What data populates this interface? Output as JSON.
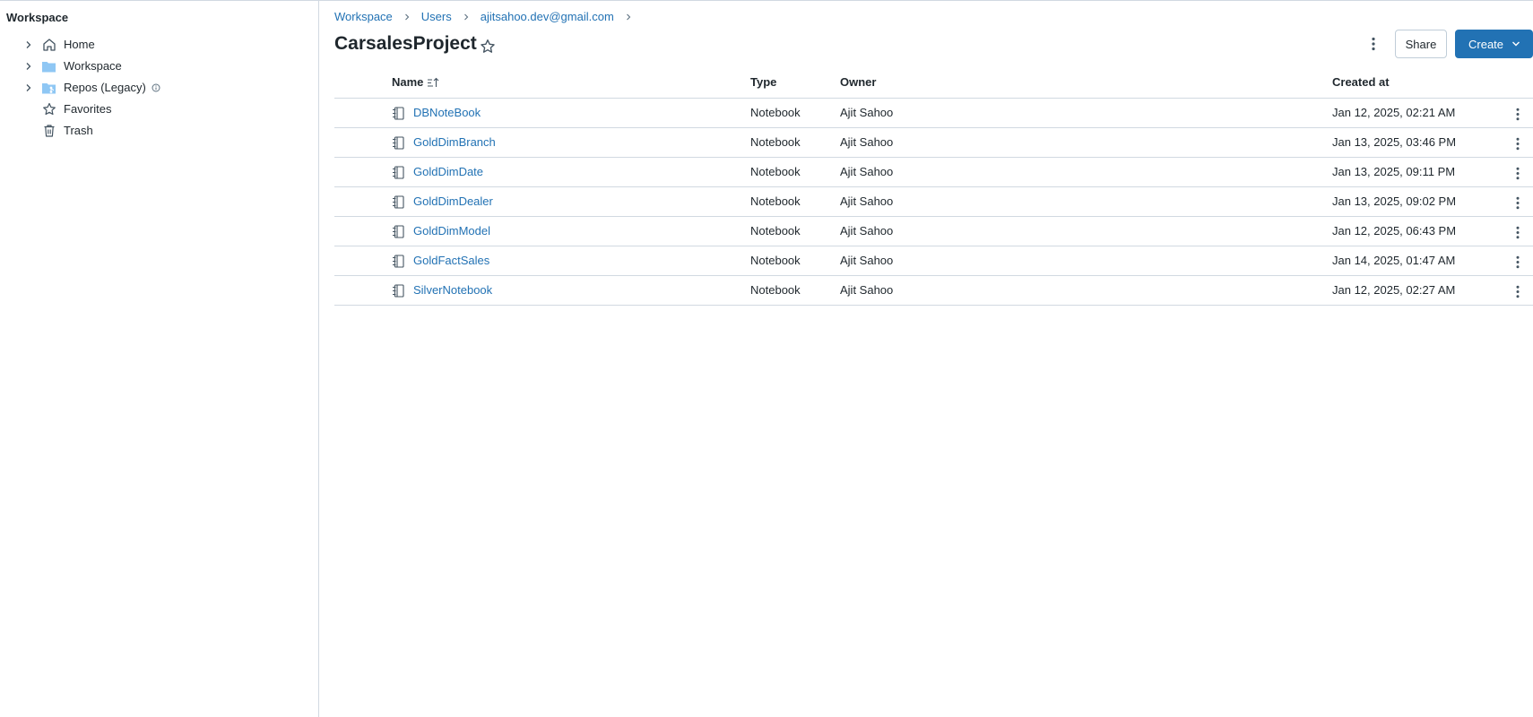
{
  "sidebar": {
    "title": "Workspace",
    "items": [
      {
        "label": "Home",
        "icon": "home-icon",
        "expandable": true
      },
      {
        "label": "Workspace",
        "icon": "folder-icon",
        "expandable": true
      },
      {
        "label": "Repos (Legacy)",
        "icon": "repo-folder-icon",
        "expandable": true,
        "info": "info-icon"
      },
      {
        "label": "Favorites",
        "icon": "star-icon",
        "expandable": false
      },
      {
        "label": "Trash",
        "icon": "trash-icon",
        "expandable": false
      }
    ]
  },
  "breadcrumb": [
    "Workspace",
    "Users",
    "ajitsahoo.dev@gmail.com"
  ],
  "page": {
    "title": "CarsalesProject"
  },
  "actions": {
    "share_label": "Share",
    "create_label": "Create"
  },
  "table": {
    "columns": {
      "name": "Name",
      "type": "Type",
      "owner": "Owner",
      "created": "Created at"
    },
    "rows": [
      {
        "name": "DBNoteBook",
        "type": "Notebook",
        "owner": "Ajit Sahoo",
        "created": "Jan 12, 2025, 02:21 AM"
      },
      {
        "name": "GoldDimBranch",
        "type": "Notebook",
        "owner": "Ajit Sahoo",
        "created": "Jan 13, 2025, 03:46 PM"
      },
      {
        "name": "GoldDimDate",
        "type": "Notebook",
        "owner": "Ajit Sahoo",
        "created": "Jan 13, 2025, 09:11 PM"
      },
      {
        "name": "GoldDimDealer",
        "type": "Notebook",
        "owner": "Ajit Sahoo",
        "created": "Jan 13, 2025, 09:02 PM"
      },
      {
        "name": "GoldDimModel",
        "type": "Notebook",
        "owner": "Ajit Sahoo",
        "created": "Jan 12, 2025, 06:43 PM"
      },
      {
        "name": "GoldFactSales",
        "type": "Notebook",
        "owner": "Ajit Sahoo",
        "created": "Jan 14, 2025, 01:47 AM"
      },
      {
        "name": "SilverNotebook",
        "type": "Notebook",
        "owner": "Ajit Sahoo",
        "created": "Jan 12, 2025, 02:27 AM"
      }
    ]
  },
  "colors": {
    "link": "#2272b4",
    "primary_button": "#2272b4",
    "border": "#d1d9e1",
    "folder": "#8fc7f4"
  }
}
